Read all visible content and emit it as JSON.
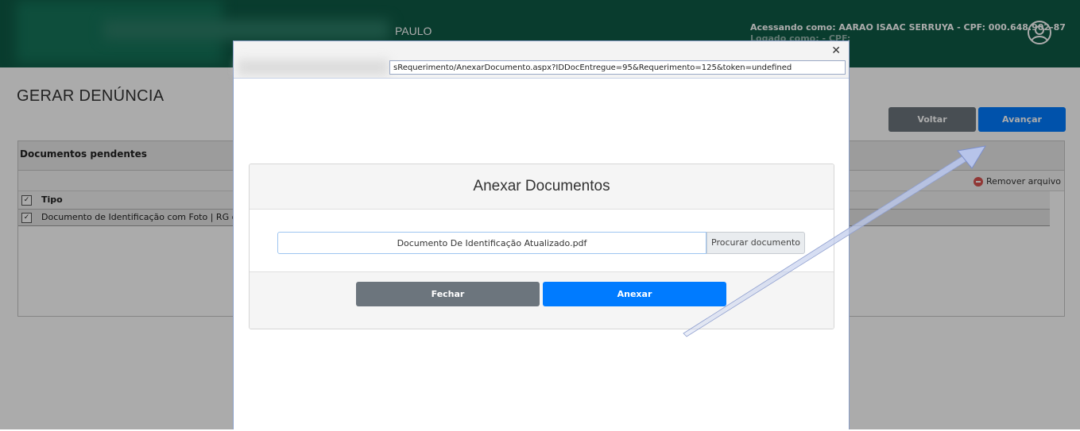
{
  "header": {
    "title_partial": "PAULO",
    "user_line1": "Acessando como: AARAO ISAAC SERRUYA - CPF: 000.648.902-87",
    "user_line2": "Logado como: - CPF:",
    "avatar_icon": "user-circle-icon"
  },
  "page": {
    "title": "GERAR DENÚNCIA",
    "voltar_label": "Voltar",
    "avancar_label": "Avançar"
  },
  "panel": {
    "title": "Documentos pendentes",
    "remove_label": "Remover arquivo",
    "col_tipo": "Tipo",
    "row_text": "Documento de Identificação com Foto | RG ou CN"
  },
  "popup": {
    "close_glyph": "✕",
    "url": "sRequerimento/AnexarDocumento.aspx?IDDocEntregue=95&Requerimento=125&token=undefined",
    "card_title": "Anexar Documentos",
    "file_name": "Documento De Identificação Atualizado.pdf",
    "browse_label": "Procurar documento",
    "close_label": "Fechar",
    "attach_label": "Anexar"
  },
  "colors": {
    "header_bg": "#0e5a45",
    "primary": "#007bff",
    "secondary": "#6c757d"
  }
}
